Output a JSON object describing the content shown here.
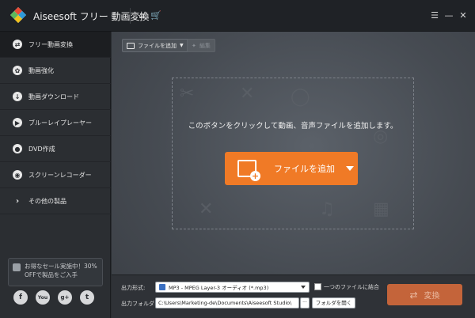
{
  "app": {
    "title": "Aiseesoft フリー 動画変換"
  },
  "titlebar_icons": [
    "home-icon",
    "cart-icon",
    "menu-icon",
    "minimize-icon",
    "close-icon"
  ],
  "sidebar": {
    "items": [
      {
        "label": "フリー動画変換",
        "icon": "convert-icon",
        "active": true
      },
      {
        "label": "動画強化",
        "icon": "enhance-icon",
        "active": false
      },
      {
        "label": "動画ダウンロード",
        "icon": "download-icon",
        "active": false
      },
      {
        "label": "ブルーレイプレーヤー",
        "icon": "play-icon",
        "active": false
      },
      {
        "label": "DVD作成",
        "icon": "disc-icon",
        "active": false
      },
      {
        "label": "スクリーンレコーダー",
        "icon": "camera-icon",
        "active": false
      },
      {
        "label": "その他の製品",
        "icon": "chevron-right-icon",
        "active": false
      }
    ],
    "promo_text": "お得なセール実施中！30% OFFで製品をご入手",
    "social": [
      "f",
      "You",
      "g+",
      "t"
    ]
  },
  "toolbar": {
    "add_file_label": "ファイルを追加",
    "edit_label": "編集"
  },
  "dropzone": {
    "hint": "このボタンをクリックして動画、音声ファイルを追加します。",
    "add_button_label": "ファイルを追加"
  },
  "bottom": {
    "format_label": "出力形式:",
    "format_value": "MP3 - MPEG Layer-3 オーディオ (*.mp3)",
    "merge_label": "一つのファイルに結合",
    "folder_label": "出力フォルダ:",
    "folder_value": "C:\\Users\\Marketing-de\\Documents\\Aiseesoft Studio\\",
    "dots_label": "···",
    "open_folder_label": "フォルダを開く",
    "convert_label": "変換"
  },
  "colors": {
    "accent": "#f07a26",
    "convert_disabled": "#c4643a"
  }
}
